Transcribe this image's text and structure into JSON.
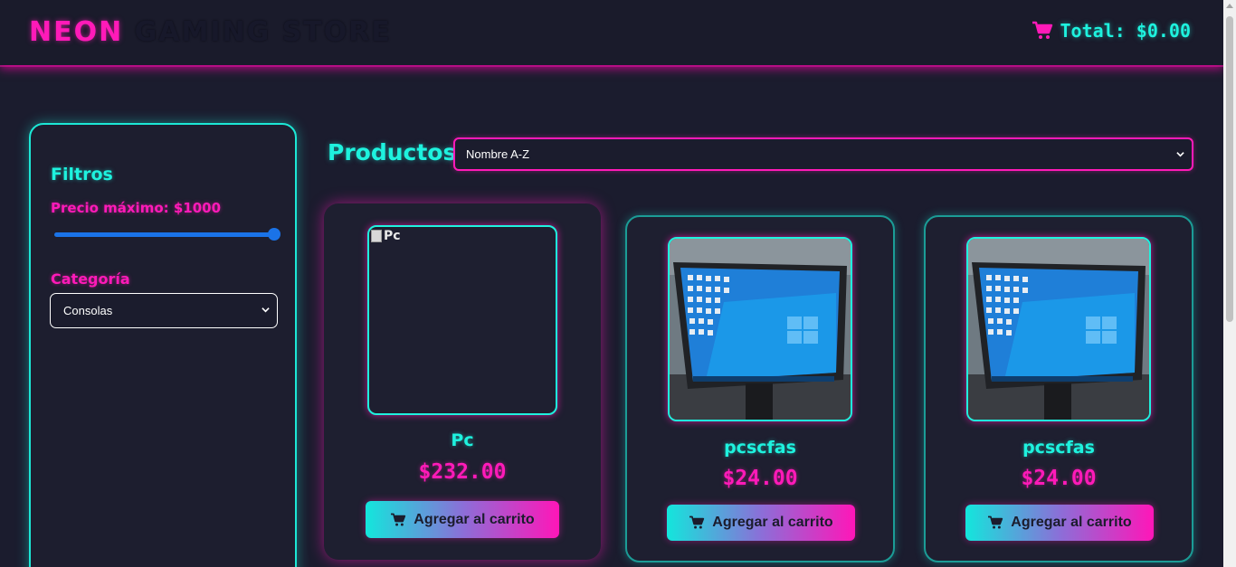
{
  "header": {
    "logo_part1": "NEON",
    "logo_part2": " GAMING STORE",
    "cart_total": "Total: $0.00",
    "cart_icon": "shopping-cart-icon"
  },
  "sidebar": {
    "title": "Filtros",
    "price_label": "Precio máximo: $1000",
    "price_slider_fraction": 1.0,
    "category_label": "Categoría",
    "category_selected": "Consolas"
  },
  "main": {
    "title": "Productos",
    "sort_selected": "Nombre A-Z"
  },
  "products": [
    {
      "name": "Pc",
      "price": "$232.00",
      "image_alt": "Pc",
      "image_broken": true,
      "button_label": "Agregar al carrito"
    },
    {
      "name": "pcscfas",
      "price": "$24.00",
      "image": "monitor-photo",
      "button_label": "Agregar al carrito"
    },
    {
      "name": "pcscfas",
      "price": "$24.00",
      "image": "monitor-photo",
      "button_label": "Agregar al carrito"
    }
  ],
  "colors": {
    "background": "#1b1c2e",
    "neon_pink": "#ff1ab8",
    "neon_cyan": "#1ef2de"
  }
}
